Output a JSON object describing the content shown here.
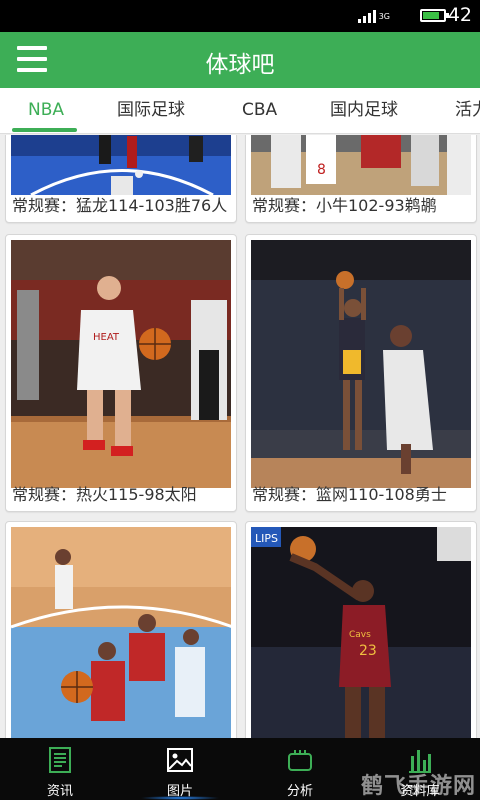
{
  "status_bar": {
    "network": "3G",
    "time": "42",
    "battery_level": 0.8,
    "colors": {
      "battery": "#3bbf45"
    }
  },
  "app_bar": {
    "title": "体球吧",
    "menu_icon": "hamburger-menu-icon",
    "color": "#3dae56"
  },
  "tabs": [
    {
      "label": "NBA",
      "active": true
    },
    {
      "label": "国际足球",
      "active": false
    },
    {
      "label": "CBA",
      "active": false
    },
    {
      "label": "国内足球",
      "active": false
    },
    {
      "label": "活力",
      "active": false
    }
  ],
  "gallery": {
    "items": [
      {
        "caption": "常规赛：猛龙114-103胜76人"
      },
      {
        "caption": "常规赛：小牛102-93鹈鹕"
      },
      {
        "caption": "常规赛：热火115-98太阳"
      },
      {
        "caption": "常规赛：篮网110-108勇士"
      },
      {
        "caption": ""
      },
      {
        "caption": ""
      }
    ]
  },
  "bottom_nav": {
    "items": [
      {
        "label": "资讯",
        "icon": "news-document-icon",
        "active": false
      },
      {
        "label": "图片",
        "icon": "picture-icon",
        "active": true
      },
      {
        "label": "分析",
        "icon": "analysis-icon",
        "active": false
      },
      {
        "label": "资料库",
        "icon": "bar-chart-icon",
        "active": false
      }
    ]
  },
  "watermark": "鹤飞手游网",
  "colors": {
    "accent": "#3dae56",
    "nav_background": "#0a0a0a",
    "active_glow": "#2a8cff"
  }
}
